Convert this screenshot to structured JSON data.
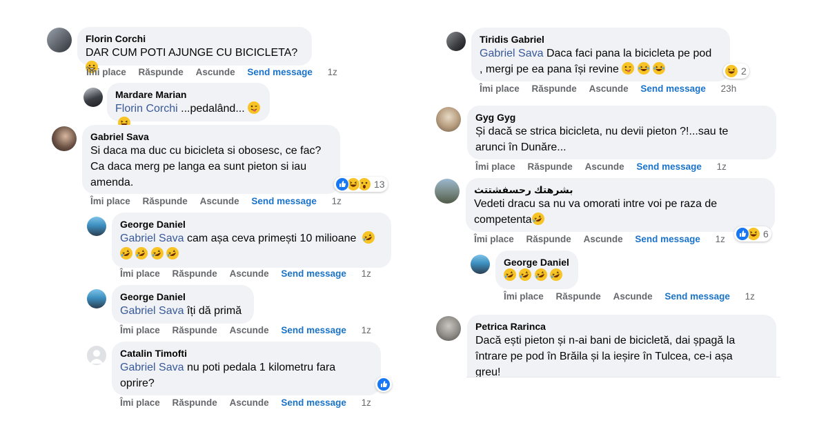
{
  "actions": {
    "like": "Îmi place",
    "reply": "Răspunde",
    "hide": "Ascunde",
    "send": "Send message"
  },
  "comments": [
    {
      "name": "Florin Corchi",
      "text": "DAR CUM POTI AJUNGE CU BICICLETA?",
      "time": "1z",
      "emoji": "grin"
    },
    {
      "name": "Mardare Marian",
      "mention": "Florin Corchi",
      "text": " ...pedalând...",
      "emoji": "wink tongue"
    },
    {
      "name": "Gabriel Sava",
      "lines": [
        "Si daca ma duc cu bicicleta si obosesc, ce fac?",
        "Ca daca merg pe langa ea sunt pieton si iau",
        "amenda."
      ],
      "time": "1z",
      "reaction_count": "13"
    },
    {
      "name": "George Daniel",
      "mention": "Gabriel Sava",
      "text": " cam așa ceva primești 10 milioane",
      "time": "1z",
      "emoji": "rolling x5"
    },
    {
      "name": "George Daniel",
      "mention": "Gabriel Sava",
      "text": " îți dă primă",
      "time": "1z"
    },
    {
      "name": "Catalin Timofti",
      "mention": "Gabriel Sava",
      "lines": [
        " nu poti pedala 1 kilometru fara",
        "oprire?"
      ],
      "time": "1z",
      "reaction": "like"
    },
    {
      "name": "Tiridis Gabriel",
      "mention": "Gabriel Sava",
      "lines": [
        " Daca faci pana la bicicleta pe pod",
        ", mergi pe ea pana își revine"
      ],
      "time": "23h",
      "reaction_count": "2"
    },
    {
      "name": "Gyg Gyg",
      "lines": [
        "Și dacă se strica bicicleta, nu devii pieton ?!...sau te",
        "arunci în Dunăre..."
      ],
      "time": "1z"
    },
    {
      "name": "بشرهتك رحسفشتتث",
      "lines": [
        "Vedeti dracu sa nu va omorati intre voi pe raza de",
        "competenta"
      ],
      "time": "1z",
      "reaction_count": "6"
    },
    {
      "name": "George Daniel",
      "time": "1z",
      "emoji": "rolling x4"
    },
    {
      "name": "Petrica Rarinca",
      "lines": [
        "Dacă ești pieton și n-ai bani de bicicletă, dai șpagă la",
        "întrare pe pod în Brăila și la ieșire în Tulcea, ce-i așa",
        "greu!"
      ]
    }
  ]
}
